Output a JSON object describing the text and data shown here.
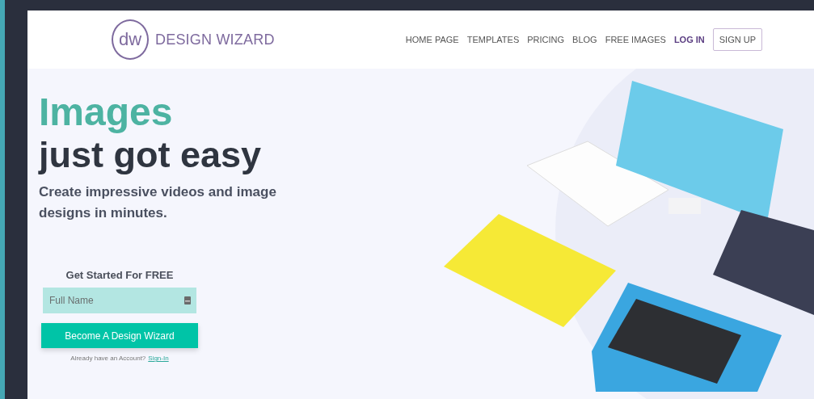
{
  "logo": {
    "mark": "dw",
    "name": "DESIGN WIZARD"
  },
  "nav": [
    {
      "label": "HOME PAGE",
      "kind": "link"
    },
    {
      "label": "TEMPLATES",
      "kind": "link"
    },
    {
      "label": "PRICING",
      "kind": "link"
    },
    {
      "label": "BLOG",
      "kind": "link"
    },
    {
      "label": "FREE IMAGES",
      "kind": "link"
    },
    {
      "label": "LOG IN",
      "kind": "accent"
    },
    {
      "label": "SIGN UP",
      "kind": "outlined"
    }
  ],
  "hero": {
    "title": "Images",
    "subtitle": "just got easy",
    "description": "Create impressive videos and image designs in minutes."
  },
  "signup": {
    "heading": "Get Started For FREE",
    "placeholder": "Full Name",
    "button": "Become A Design Wizard",
    "prompt": "Already have an Account?",
    "link": "Sign-In"
  }
}
